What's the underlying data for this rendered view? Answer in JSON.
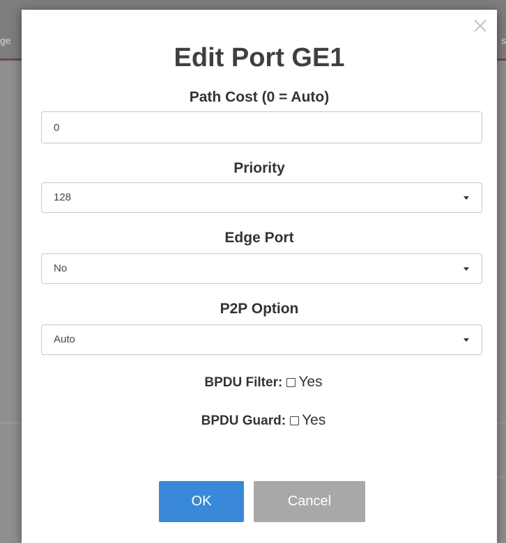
{
  "background": {
    "left_fragment": "ge",
    "right_fragment": "s"
  },
  "dialog": {
    "title": "Edit Port GE1",
    "close_symbol": "close-icon",
    "path_cost": {
      "label": "Path Cost (0 = Auto)",
      "value": "0"
    },
    "priority": {
      "label": "Priority",
      "selected": "128"
    },
    "edge_port": {
      "label": "Edge Port",
      "selected": "No"
    },
    "p2p_option": {
      "label": "P2P Option",
      "selected": "Auto"
    },
    "bpdu_filter": {
      "label": "BPDU Filter:",
      "option": "Yes",
      "checked": false
    },
    "bpdu_guard": {
      "label": "BPDU Guard:",
      "option": "Yes",
      "checked": false
    },
    "buttons": {
      "ok": "OK",
      "cancel": "Cancel"
    }
  },
  "colors": {
    "ok_button": "#3989d8",
    "cancel_button": "#a8a8a8",
    "title_text": "#3f3f3f",
    "overlay": "#8f8f8f"
  }
}
